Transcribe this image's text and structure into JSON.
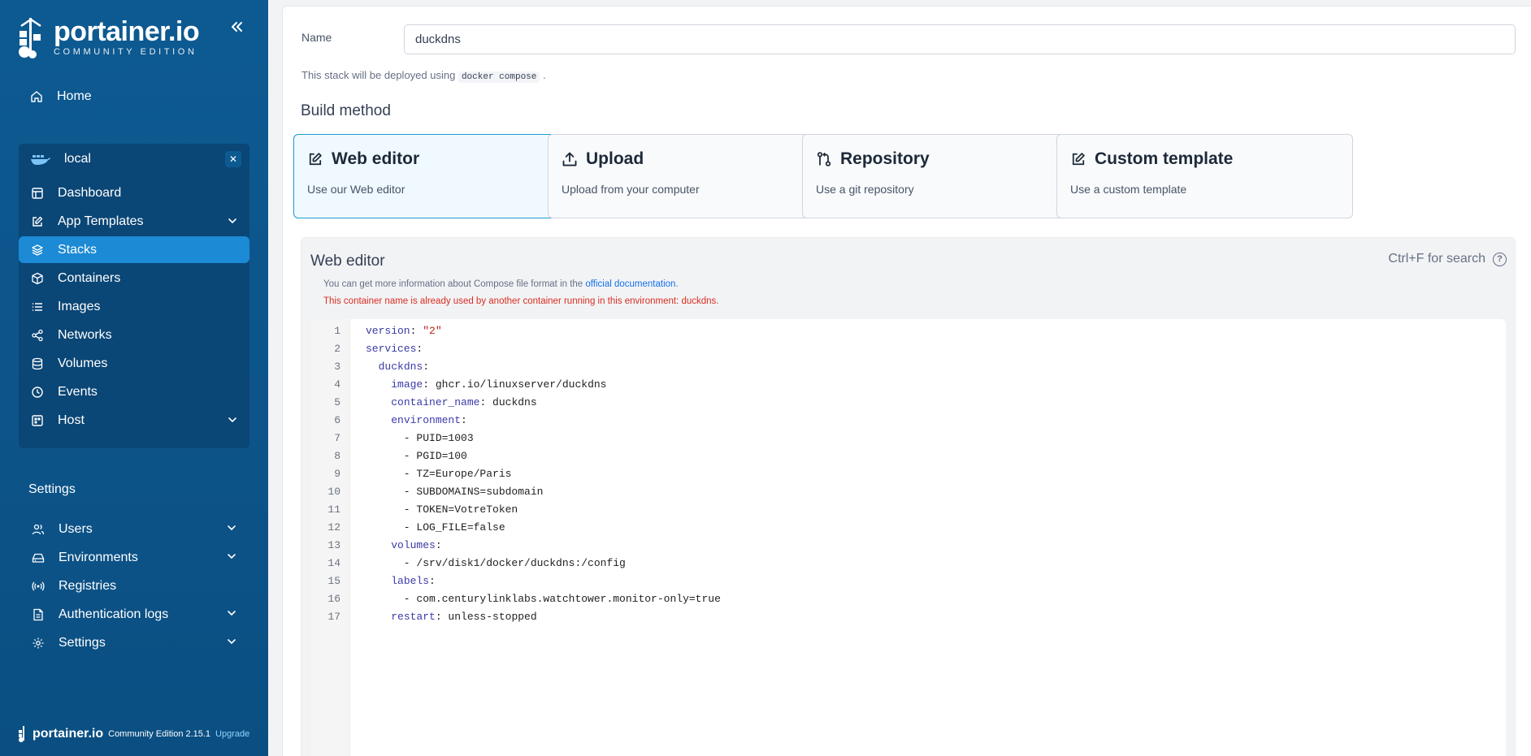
{
  "brand": {
    "name": "portainer.io",
    "edition": "COMMUNITY EDITION"
  },
  "sidebar": {
    "home": "Home",
    "environment": {
      "name": "local"
    },
    "env_items": [
      {
        "label": "Dashboard",
        "icon": "dashboard-icon",
        "chevron": false
      },
      {
        "label": "App Templates",
        "icon": "edit-icon",
        "chevron": true
      },
      {
        "label": "Stacks",
        "icon": "layers-icon",
        "chevron": false,
        "active": true
      },
      {
        "label": "Containers",
        "icon": "box-icon",
        "chevron": false
      },
      {
        "label": "Images",
        "icon": "list-icon",
        "chevron": false
      },
      {
        "label": "Networks",
        "icon": "network-icon",
        "chevron": false
      },
      {
        "label": "Volumes",
        "icon": "database-icon",
        "chevron": false
      },
      {
        "label": "Events",
        "icon": "clock-icon",
        "chevron": false
      },
      {
        "label": "Host",
        "icon": "host-icon",
        "chevron": true
      }
    ],
    "settings_title": "Settings",
    "settings_items": [
      {
        "label": "Users",
        "icon": "users-icon",
        "chevron": true
      },
      {
        "label": "Environments",
        "icon": "hdd-icon",
        "chevron": true
      },
      {
        "label": "Registries",
        "icon": "radio-icon",
        "chevron": false
      },
      {
        "label": "Authentication logs",
        "icon": "file-text-icon",
        "chevron": true
      },
      {
        "label": "Settings",
        "icon": "gear-icon",
        "chevron": true
      }
    ],
    "footer": {
      "name": "portainer.io",
      "edition": "Community Edition",
      "version": "2.15.1",
      "upgrade": "Upgrade"
    }
  },
  "form": {
    "name_label": "Name",
    "name_value": "duckdns",
    "deploy_note_prefix": "This stack will be deployed using",
    "deploy_note_code": "docker compose",
    "deploy_note_suffix": "."
  },
  "build_method": {
    "title": "Build method",
    "options": [
      {
        "title": "Web editor",
        "desc": "Use our Web editor",
        "icon": "edit-icon",
        "selected": true
      },
      {
        "title": "Upload",
        "desc": "Upload from your computer",
        "icon": "upload-icon",
        "selected": false
      },
      {
        "title": "Repository",
        "desc": "Use a git repository",
        "icon": "git-icon",
        "selected": false
      },
      {
        "title": "Custom template",
        "desc": "Use a custom template",
        "icon": "edit-icon",
        "selected": false
      }
    ]
  },
  "editor": {
    "title": "Web editor",
    "search_hint": "Ctrl+F for search",
    "info_prefix": "You can get more information about Compose file format in the",
    "info_link": "official documentation",
    "info_suffix": ".",
    "warning": "This container name is already used by another container running in this environment: duckdns.",
    "lines": [
      "version: \"2\"",
      "services:",
      "  duckdns:",
      "    image: ghcr.io/linuxserver/duckdns",
      "    container_name: duckdns",
      "    environment:",
      "      - PUID=1003",
      "      - PGID=100",
      "      - TZ=Europe/Paris",
      "      - SUBDOMAINS=subdomain",
      "      - TOKEN=VotreToken",
      "      - LOG_FILE=false",
      "    volumes:",
      "      - /srv/disk1/docker/duckdns:/config",
      "    labels:",
      "      - com.centurylinklabs.watchtower.monitor-only=true",
      "    restart: unless-stopped"
    ]
  }
}
